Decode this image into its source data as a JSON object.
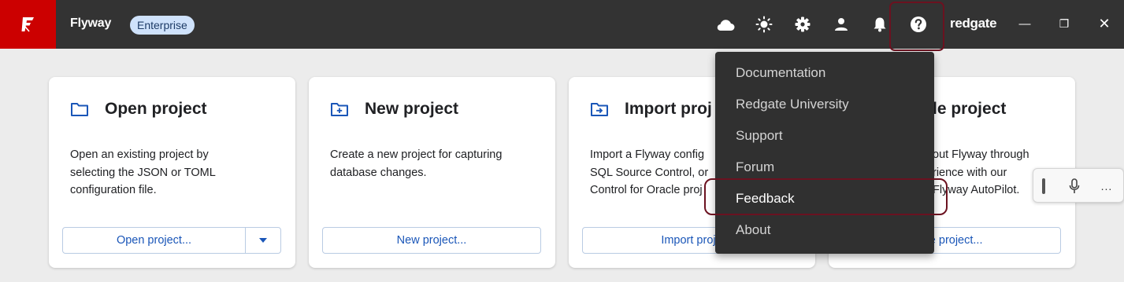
{
  "header": {
    "app_title": "Flyway",
    "edition_badge": "Enterprise",
    "brand": "redgate",
    "icons": [
      "cloud-icon",
      "sun-icon",
      "gear-icon",
      "user-icon",
      "bell-icon",
      "help-icon"
    ],
    "window_controls": {
      "minimize": "—",
      "restore": "❐",
      "close": "✕"
    },
    "colors": {
      "bar": "#333333",
      "logo_bg": "#cc0000",
      "badge_bg": "#cfe2fb"
    }
  },
  "cards": [
    {
      "title": "Open project",
      "icon": "folder-icon",
      "description": [
        "Open an existing project by",
        "selecting the JSON or TOML",
        "configuration file."
      ],
      "button": "Open project..."
    },
    {
      "title": "New project",
      "icon": "new-folder-icon",
      "description": [
        "Create a new project for capturing",
        "database changes."
      ],
      "button": "New project..."
    },
    {
      "title": "Import proj",
      "icon": "import-folder-icon",
      "description": [
        "Import a Flyway config",
        "SQL Source Control, or",
        "Control for Oracle proj"
      ],
      "button": "Import proje"
    },
    {
      "title": "le project",
      "description": [
        "out Flyway through",
        "rience with our",
        "Flyway AutoPilot."
      ],
      "button": "ple project..."
    }
  ],
  "help_menu": {
    "items": [
      "Documentation",
      "Redgate University",
      "Support",
      "Forum",
      "Feedback",
      "About"
    ],
    "highlighted": "Feedback"
  },
  "floating_toolbar": {
    "more_label": "..."
  },
  "accent": {
    "button_text": "#1a56b8",
    "highlight": "#6b1220"
  }
}
